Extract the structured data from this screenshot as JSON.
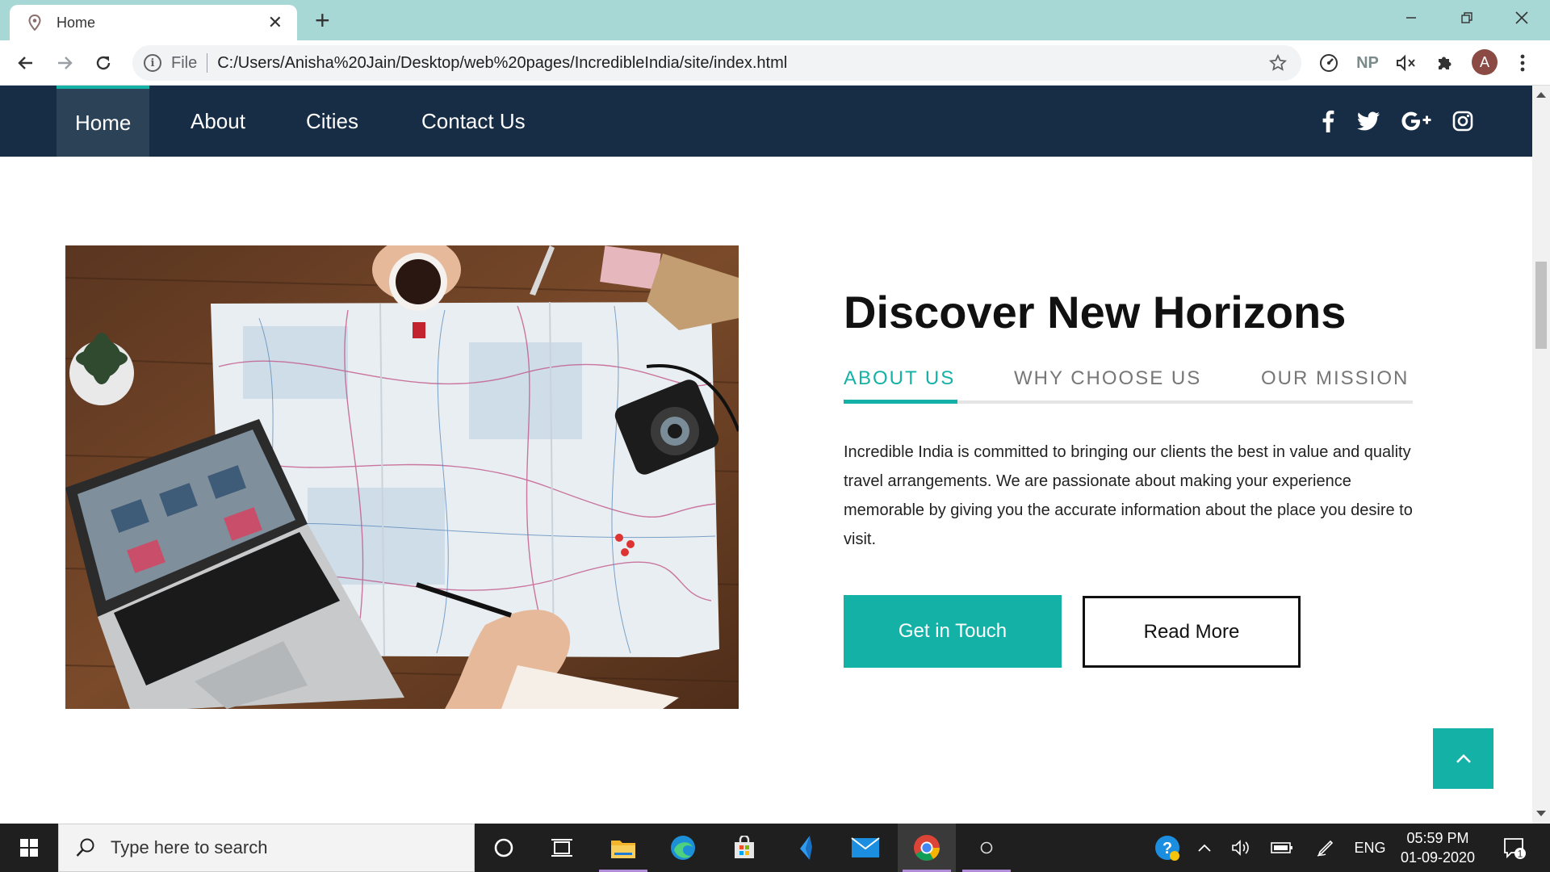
{
  "browser": {
    "tab_title": "Home",
    "address_scheme": "File",
    "url": "C:/Users/Anisha%20Jain/Desktop/web%20pages/IncredibleIndia/site/index.html",
    "profile_initial": "A",
    "extensions": [
      "speed-dial-icon",
      "np-extension-icon",
      "mute-icon",
      "puzzle-icon"
    ],
    "np_label": "NP"
  },
  "site": {
    "nav": [
      "Home",
      "About",
      "Cities",
      "Contact Us"
    ],
    "social": [
      "facebook-icon",
      "twitter-icon",
      "google-plus-icon",
      "instagram-icon"
    ],
    "heading": "Discover New Horizons",
    "tabs": [
      "ABOUT US",
      "WHY CHOOSE US",
      "OUR MISSION"
    ],
    "active_tab": "ABOUT US",
    "paragraph": "Incredible India is committed to bringing our clients the best in value and quality travel arrangements. We are passionate about making your experience memorable by giving you the accurate information about the place you desire to visit.",
    "primary_button": "Get in Touch",
    "secondary_button": "Read More",
    "accent": "#14b1a6",
    "nav_bg": "#172d45"
  },
  "taskbar": {
    "search_placeholder": "Type here to search",
    "lang": "ENG",
    "time": "05:59 PM",
    "date": "01-09-2020",
    "notification_count": "1"
  }
}
